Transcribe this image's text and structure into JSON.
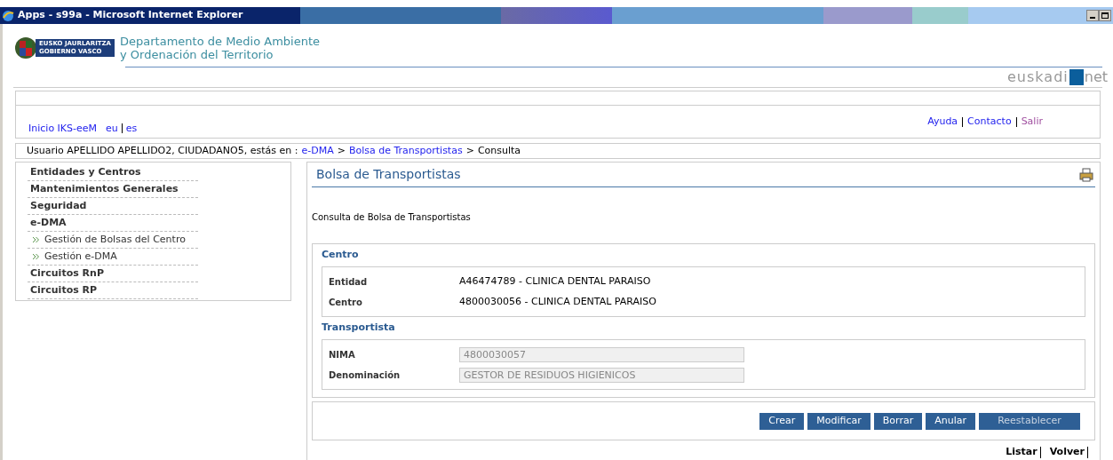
{
  "window": {
    "title": "Apps - s99a - Microsoft Internet Explorer"
  },
  "header": {
    "logo_lines": [
      "EUSKO JAURLARITZA",
      "GOBIERNO VASCO"
    ],
    "department": [
      "Departamento de Medio Ambiente",
      "y Ordenación del Territorio"
    ],
    "portal_logo": [
      "euskadi",
      "net"
    ]
  },
  "top_links": {
    "left": [
      {
        "label": "Inicio IKS-eeM"
      },
      {
        "label": "eu"
      },
      {
        "label": "es"
      }
    ],
    "right": [
      {
        "label": "Ayuda",
        "visited": false
      },
      {
        "label": "Contacto",
        "visited": false
      },
      {
        "label": "Salir",
        "visited": true
      }
    ]
  },
  "breadcrumb": {
    "prefix": "Usuario APELLIDO APELLIDO2, CIUDADANO5, estás en :",
    "items": [
      {
        "kind": "link",
        "label": "e-DMA"
      },
      {
        "kind": "separator",
        "label": ">"
      },
      {
        "kind": "link",
        "label": "Bolsa de Transportistas"
      },
      {
        "kind": "separator",
        "label": ">"
      },
      {
        "kind": "current",
        "label": "Consulta"
      }
    ]
  },
  "sidebar": {
    "items": [
      {
        "label": "Entidades y Centros"
      },
      {
        "label": "Mantenimientos Generales"
      },
      {
        "label": "Seguridad"
      },
      {
        "label": "e-DMA",
        "children": [
          {
            "label": "Gestión de Bolsas del Centro"
          },
          {
            "label": "Gestión e-DMA"
          }
        ]
      },
      {
        "label": "Circuitos RnP"
      },
      {
        "label": "Circuitos RP"
      }
    ]
  },
  "main": {
    "title": "Bolsa de Transportistas",
    "subtitle": "Consulta de Bolsa de Transportistas",
    "sections": [
      {
        "title": "Centro",
        "fields": [
          {
            "kind": "text",
            "label": "Entidad",
            "value": "A46474789 - CLINICA DENTAL PARAISO"
          },
          {
            "kind": "text",
            "label": "Centro",
            "value": "4800030056 - CLINICA DENTAL PARAISO"
          }
        ]
      },
      {
        "title": "Transportista",
        "fields": [
          {
            "kind": "input",
            "label": "NIMA",
            "value": "4800030057",
            "disabled": true
          },
          {
            "kind": "input",
            "label": "Denominación",
            "value": "GESTOR DE RESIDUOS HIGIENICOS",
            "disabled": true
          }
        ]
      }
    ],
    "buttons": [
      {
        "label": "Crear",
        "disabled": false
      },
      {
        "label": "Modificar",
        "disabled": false
      },
      {
        "label": "Borrar",
        "disabled": false
      },
      {
        "label": "Anular",
        "disabled": false
      },
      {
        "label": "Reestablecer",
        "disabled": true
      }
    ],
    "footer_links": [
      {
        "label": "Listar"
      },
      {
        "label": "Volver"
      }
    ]
  }
}
